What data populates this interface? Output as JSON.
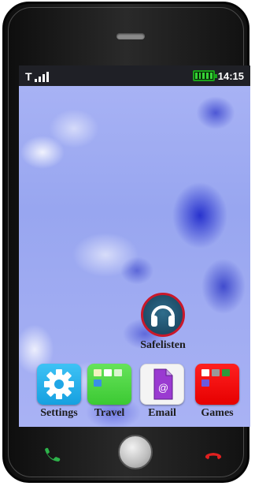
{
  "status_bar": {
    "signal_letter": "T",
    "battery_level": 1.0,
    "time": "14:15"
  },
  "home_apps": {
    "safelisten": {
      "label": "Safelisten",
      "icon": "headphones-icon"
    }
  },
  "dock_apps": [
    {
      "label": "Settings",
      "icon": "gear-icon",
      "color": "#1fb2ee"
    },
    {
      "label": "Travel",
      "icon": "travel-grid-icon",
      "color": "#48d23d"
    },
    {
      "label": "Email",
      "icon": "email-document-icon",
      "color": "#8b2fc9"
    },
    {
      "label": "Games",
      "icon": "games-grid-icon",
      "color": "#f01010"
    }
  ],
  "hardware": {
    "call_button_color": "#2db34a",
    "end_call_button_color": "#e02020"
  }
}
